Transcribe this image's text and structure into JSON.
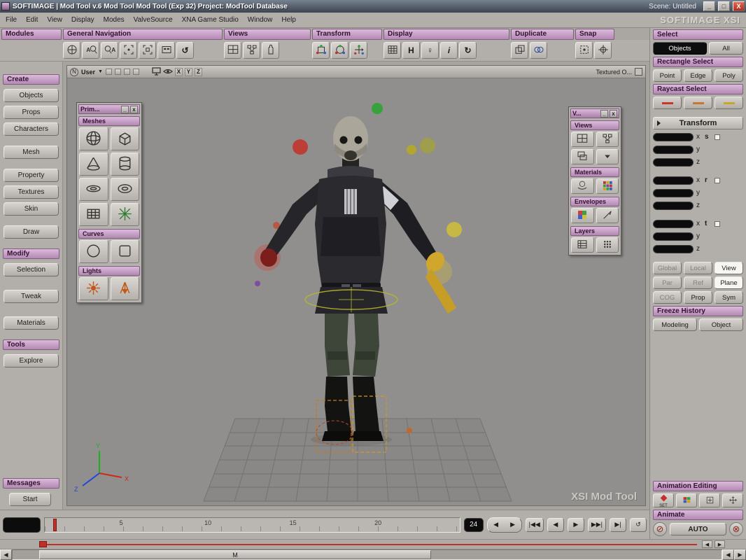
{
  "window": {
    "title": "SOFTIMAGE | Mod Tool v.6 Mod Tool Mod Tool (Exp 32) Project: ModTool Database",
    "scene": "Scene: Untitled",
    "minimize": "_",
    "maximize": "□",
    "close": "X",
    "brand": "SOFTIMAGE XSI"
  },
  "menubar": {
    "items": [
      "File",
      "Edit",
      "View",
      "Display",
      "Modes",
      "ValveSource",
      "XNA Game Studio",
      "Window",
      "Help"
    ]
  },
  "toolbar": {
    "sections": [
      "Modules",
      "General Navigation",
      "Views",
      "Transform",
      "Display",
      "Duplicate",
      "Snap"
    ]
  },
  "sidebar": {
    "create_header": "Create",
    "create_items": [
      "Objects",
      "Props",
      "Characters",
      "Mesh",
      "Property",
      "Textures",
      "Skin",
      "Draw"
    ],
    "modify_header": "Modify",
    "modify_items": [
      "Selection",
      "Tweak",
      "Materials"
    ],
    "tools_header": "Tools",
    "tools_items": [
      "Explore"
    ],
    "messages_header": "Messages",
    "messages_items": [
      "Start"
    ]
  },
  "viewport": {
    "id_letter": "N",
    "camera": "User",
    "dropdown": "▼",
    "axis_x": "X",
    "axis_y": "Y",
    "axis_z": "Z",
    "display_mode": "Textured O...",
    "watermark": "XSI Mod Tool"
  },
  "prim_palette": {
    "title": "Prim...",
    "minimize": "_",
    "close": "x",
    "meshes": "Meshes",
    "curves": "Curves",
    "lights": "Lights"
  },
  "views_palette": {
    "title": "V...",
    "minimize": "_",
    "close": "x",
    "views": "Views",
    "materials": "Materials",
    "envelopes": "Envelopes",
    "layers": "Layers"
  },
  "right_panel": {
    "select_header": "Select",
    "objects": "Objects",
    "all": "All",
    "rect_header": "Rectangle Select",
    "point": "Point",
    "edge": "Edge",
    "poly": "Poly",
    "raycast_header": "Raycast Select",
    "transform_header": "Transform",
    "axis_x": "x",
    "axis_y": "y",
    "axis_z": "z",
    "group_s": "s",
    "group_r": "r",
    "group_t": "t",
    "global": "Global",
    "local": "Local",
    "view": "View",
    "par": "Par",
    "ref": "Ref",
    "plane": "Plane",
    "cog": "COG",
    "prop": "Prop",
    "sym": "Sym",
    "freeze_header": "Freeze History",
    "modeling": "Modeling",
    "object": "Object",
    "anim_header": "Animation Editing",
    "set": "SET",
    "animate_header": "Animate",
    "no_key": "⊘",
    "auto": "AUTO",
    "del_key": "⊗"
  },
  "timeline": {
    "current_frame": "24",
    "numbers": [
      "5",
      "10",
      "15",
      "20"
    ],
    "play_pair": [
      "◀",
      "▶"
    ],
    "buttons": [
      "|◀◀",
      "◀",
      "▶",
      "▶▶|",
      "▶|",
      "↺"
    ],
    "thumb": "M",
    "arrow_left": "◀",
    "arrow_right": "▶"
  }
}
